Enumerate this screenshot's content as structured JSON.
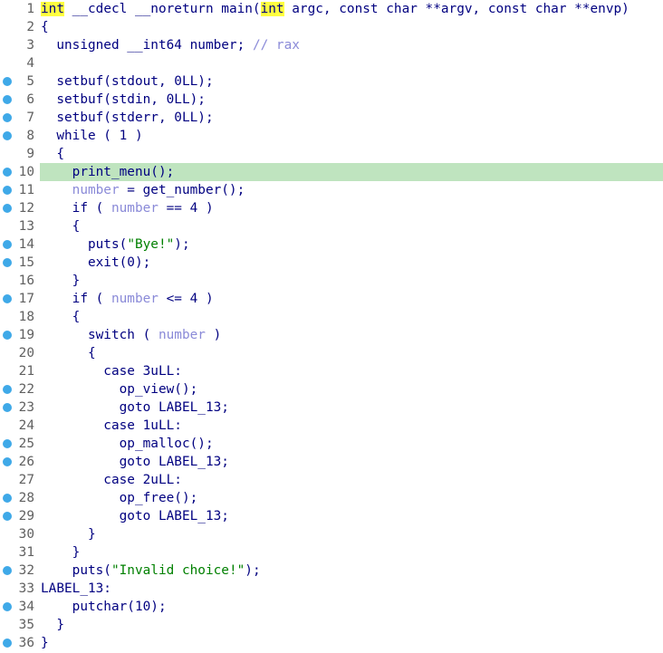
{
  "colors": {
    "line_number": "#606060",
    "code_text": "#000080",
    "local_variable": "#8a8ad8",
    "string_literal": "#008000",
    "keyword_highlight": "#ffff40",
    "current_line": "#bfe4bf",
    "breakpoint_dot": "#3fa9e8"
  },
  "current_line": 10,
  "lines": [
    {
      "n": "1",
      "bp": false,
      "segs": [
        {
          "t": "int",
          "c": "kwhl"
        },
        {
          "t": " __cdecl __noreturn main("
        },
        {
          "t": "int",
          "c": "kwhl"
        },
        {
          "t": " argc, const char **argv, const char **envp)"
        }
      ]
    },
    {
      "n": "2",
      "bp": false,
      "segs": [
        {
          "t": "{"
        }
      ]
    },
    {
      "n": "3",
      "bp": false,
      "segs": [
        {
          "t": "  unsigned __int64 number; "
        },
        {
          "t": "// rax",
          "c": "cmt"
        }
      ]
    },
    {
      "n": "4",
      "bp": false,
      "segs": []
    },
    {
      "n": "5",
      "bp": true,
      "segs": [
        {
          "t": "  setbuf(stdout, 0LL);"
        }
      ]
    },
    {
      "n": "6",
      "bp": true,
      "segs": [
        {
          "t": "  setbuf(stdin, 0LL);"
        }
      ]
    },
    {
      "n": "7",
      "bp": true,
      "segs": [
        {
          "t": "  setbuf(stderr, 0LL);"
        }
      ]
    },
    {
      "n": "8",
      "bp": true,
      "segs": [
        {
          "t": "  while ( 1 )"
        }
      ]
    },
    {
      "n": "9",
      "bp": false,
      "segs": [
        {
          "t": "  {"
        }
      ]
    },
    {
      "n": "10",
      "bp": true,
      "segs": [
        {
          "t": "    print_menu();"
        }
      ]
    },
    {
      "n": "11",
      "bp": true,
      "segs": [
        {
          "t": "    "
        },
        {
          "t": "number",
          "c": "var"
        },
        {
          "t": " = get_number();"
        }
      ]
    },
    {
      "n": "12",
      "bp": true,
      "segs": [
        {
          "t": "    if ( "
        },
        {
          "t": "number",
          "c": "var"
        },
        {
          "t": " == 4 )"
        }
      ]
    },
    {
      "n": "13",
      "bp": false,
      "segs": [
        {
          "t": "    {"
        }
      ]
    },
    {
      "n": "14",
      "bp": true,
      "segs": [
        {
          "t": "      puts("
        },
        {
          "t": "\"Bye!\"",
          "c": "str"
        },
        {
          "t": ");"
        }
      ]
    },
    {
      "n": "15",
      "bp": true,
      "segs": [
        {
          "t": "      exit(0);"
        }
      ]
    },
    {
      "n": "16",
      "bp": false,
      "segs": [
        {
          "t": "    }"
        }
      ]
    },
    {
      "n": "17",
      "bp": true,
      "segs": [
        {
          "t": "    if ( "
        },
        {
          "t": "number",
          "c": "var"
        },
        {
          "t": " <= 4 )"
        }
      ]
    },
    {
      "n": "18",
      "bp": false,
      "segs": [
        {
          "t": "    {"
        }
      ]
    },
    {
      "n": "19",
      "bp": true,
      "segs": [
        {
          "t": "      switch ( "
        },
        {
          "t": "number",
          "c": "var"
        },
        {
          "t": " )"
        }
      ]
    },
    {
      "n": "20",
      "bp": false,
      "segs": [
        {
          "t": "      {"
        }
      ]
    },
    {
      "n": "21",
      "bp": false,
      "segs": [
        {
          "t": "        case 3uLL:"
        }
      ]
    },
    {
      "n": "22",
      "bp": true,
      "segs": [
        {
          "t": "          op_view();"
        }
      ]
    },
    {
      "n": "23",
      "bp": true,
      "segs": [
        {
          "t": "          goto LABEL_13;"
        }
      ]
    },
    {
      "n": "24",
      "bp": false,
      "segs": [
        {
          "t": "        case 1uLL:"
        }
      ]
    },
    {
      "n": "25",
      "bp": true,
      "segs": [
        {
          "t": "          op_malloc();"
        }
      ]
    },
    {
      "n": "26",
      "bp": true,
      "segs": [
        {
          "t": "          goto LABEL_13;"
        }
      ]
    },
    {
      "n": "27",
      "bp": false,
      "segs": [
        {
          "t": "        case 2uLL:"
        }
      ]
    },
    {
      "n": "28",
      "bp": true,
      "segs": [
        {
          "t": "          op_free();"
        }
      ]
    },
    {
      "n": "29",
      "bp": true,
      "segs": [
        {
          "t": "          goto LABEL_13;"
        }
      ]
    },
    {
      "n": "30",
      "bp": false,
      "segs": [
        {
          "t": "      }"
        }
      ]
    },
    {
      "n": "31",
      "bp": false,
      "segs": [
        {
          "t": "    }"
        }
      ]
    },
    {
      "n": "32",
      "bp": true,
      "segs": [
        {
          "t": "    puts("
        },
        {
          "t": "\"Invalid choice!\"",
          "c": "str"
        },
        {
          "t": ");"
        }
      ]
    },
    {
      "n": "33",
      "bp": false,
      "segs": [
        {
          "t": "LABEL_13:"
        }
      ]
    },
    {
      "n": "34",
      "bp": true,
      "segs": [
        {
          "t": "    putchar(10);"
        }
      ]
    },
    {
      "n": "35",
      "bp": false,
      "segs": [
        {
          "t": "  }"
        }
      ]
    },
    {
      "n": "36",
      "bp": true,
      "segs": [
        {
          "t": "}"
        }
      ]
    }
  ]
}
